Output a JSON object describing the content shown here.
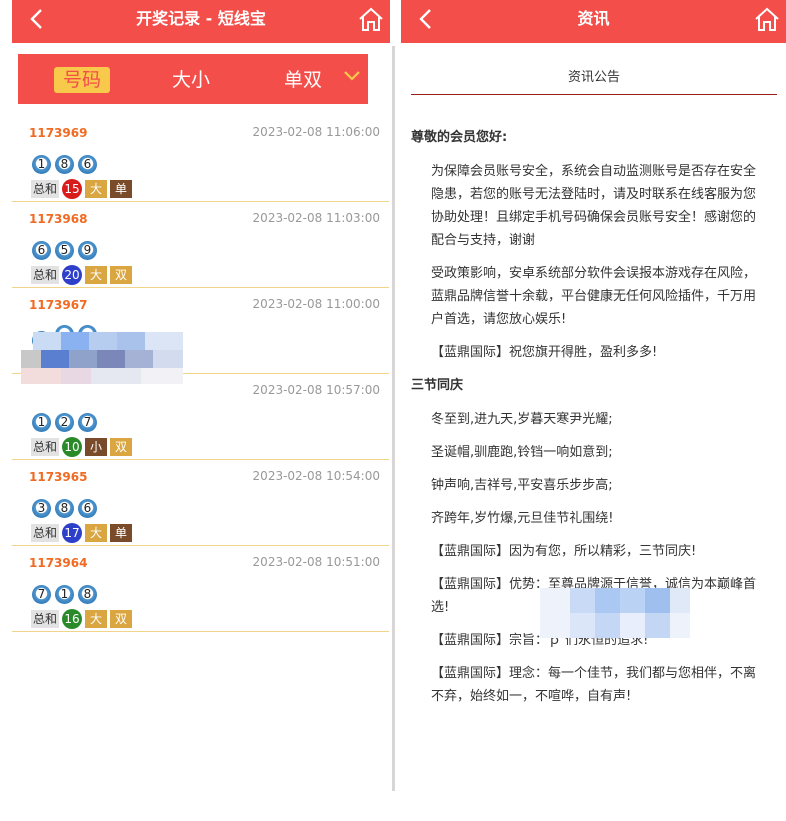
{
  "left": {
    "title": "开奖记录 - 短线宝",
    "tabs": [
      "号码",
      "大小",
      "单双"
    ],
    "active_tab": "号码",
    "draws": [
      {
        "issue": "1173969",
        "time": "2023-02-08 11:06:00",
        "balls": [
          "1",
          "8",
          "6"
        ],
        "sum_label": "总和",
        "total": "15",
        "total_color": "#d81b1b",
        "size": "大",
        "size_color": "#d9a641",
        "parity": "单",
        "parity_color": "#7a4b2b"
      },
      {
        "issue": "1173968",
        "time": "2023-02-08 11:03:00",
        "balls": [
          "6",
          "5",
          "9"
        ],
        "sum_label": "总和",
        "total": "20",
        "total_color": "#2e40c9",
        "size": "大",
        "size_color": "#d9a641",
        "parity": "双",
        "parity_color": "#d9a641"
      },
      {
        "issue": "1173967",
        "time": "2023-02-08 11:00:00",
        "balls": [
          "1",
          "",
          ""
        ],
        "sum_label": "",
        "total": "",
        "total_color": "#cccccc",
        "size": "",
        "size_color": "#cccccc",
        "parity": "",
        "parity_color": "#cccccc"
      },
      {
        "issue": "",
        "time": "2023-02-08 10:57:00",
        "balls": [
          "1",
          "2",
          "7"
        ],
        "sum_label": "总和",
        "total": "10",
        "total_color": "#2a8a2a",
        "size": "小",
        "size_color": "#7a4b2b",
        "parity": "双",
        "parity_color": "#d9a641"
      },
      {
        "issue": "1173965",
        "time": "2023-02-08 10:54:00",
        "balls": [
          "3",
          "8",
          "6"
        ],
        "sum_label": "总和",
        "total": "17",
        "total_color": "#2e40c9",
        "size": "大",
        "size_color": "#d9a641",
        "parity": "单",
        "parity_color": "#7a4b2b"
      },
      {
        "issue": "1173964",
        "time": "2023-02-08 10:51:00",
        "balls": [
          "7",
          "1",
          "8"
        ],
        "sum_label": "总和",
        "total": "16",
        "total_color": "#2a8a2a",
        "size": "大",
        "size_color": "#d9a641",
        "parity": "双",
        "parity_color": "#d9a641"
      }
    ]
  },
  "right": {
    "title": "资讯",
    "subheader": "资讯公告",
    "greeting": "尊敬的会员您好:",
    "para1": "为保障会员账号安全，系统会自动监测账号是否存在安全隐患，若您的账号无法登陆时，请及时联系在线客服为您协助处理！且绑定手机号码确保会员账号安全！感谢您的配合与支持，谢谢",
    "para2": "受政策影响，安卓系统部分软件会误报本游戏存在风险，蓝鼎品牌信誉十余载，平台健康无任何风险插件，千万用户首选，请您放心娱乐!",
    "para3": "【蓝鼎国际】祝您旗开得胜，盈利多多!",
    "section2": "三节同庆",
    "line1": "冬至到,进九天,岁暮天寒尹光耀;",
    "line2": "圣诞帽,驯鹿跑,铃铛一响如意到;",
    "line3": "钟声响,吉祥号,平安喜乐步步高;",
    "line4": "齐跨年,岁竹爆,元旦佳节礼围绕!",
    "line5": "【蓝鼎国际】因为有您，所以精彩，三节同庆!",
    "line6": "【蓝鼎国际】优势：至尊品牌源于信誉，诚信为本巅峰首选!",
    "line7": "【蓝鼎国际】宗旨：ｐ 们永恒的追求!",
    "line8": "【蓝鼎国际】理念：每一个佳节，我们都与您相伴，不离不弃，始终如一，不喧哗，自有声!"
  },
  "icons": [
    "back-arrow-icon",
    "home-icon",
    "chevron-down-icon"
  ]
}
